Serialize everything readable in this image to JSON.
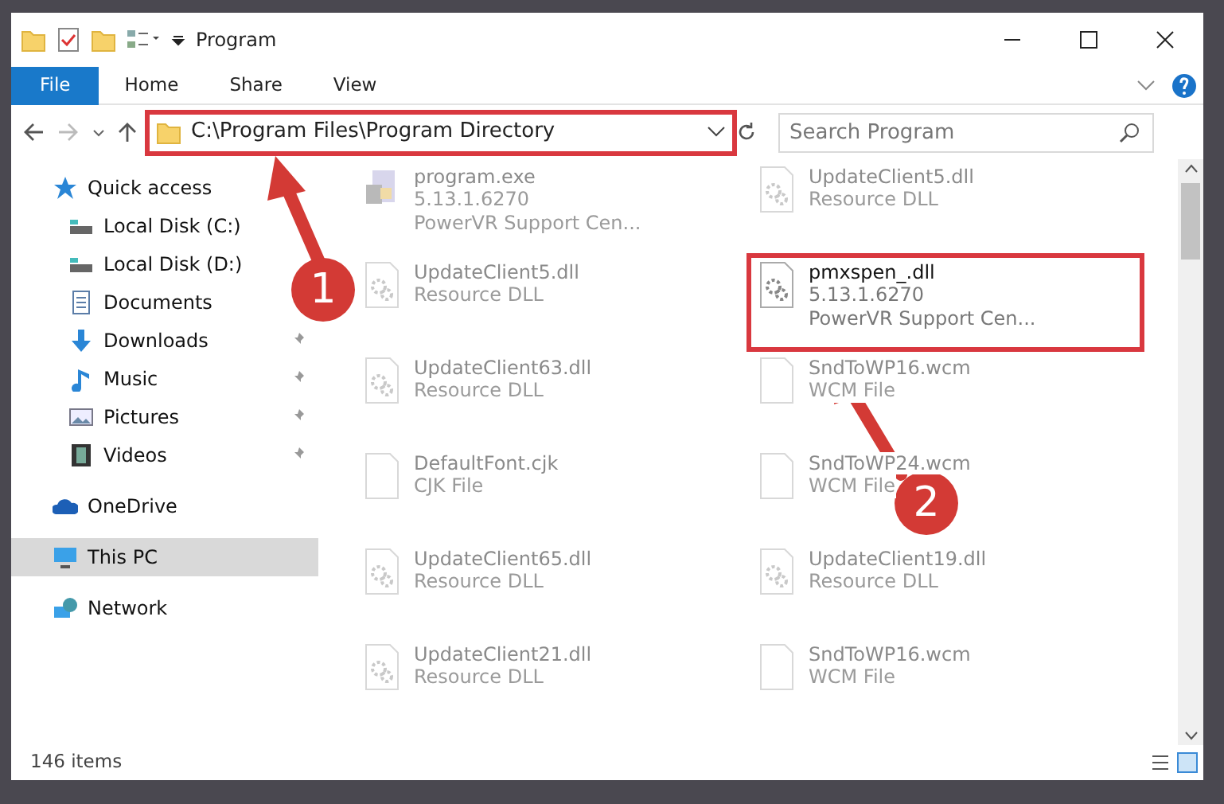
{
  "window": {
    "title": "Program"
  },
  "ribbon_tabs": [
    {
      "label": "File",
      "selected": true
    },
    {
      "label": "Home",
      "selected": false
    },
    {
      "label": "Share",
      "selected": false
    },
    {
      "label": "View",
      "selected": false
    }
  ],
  "address": {
    "value": "C:\\Program Files\\Program Directory",
    "highlighted": true
  },
  "search": {
    "placeholder": "Search Program"
  },
  "sidebar": [
    {
      "label": "Quick access",
      "kind": "star",
      "selected": false,
      "children": [
        {
          "label": "Local Disk (C:)",
          "kind": "drive",
          "pinned": false,
          "selected": false
        },
        {
          "label": "Local Disk (D:)",
          "kind": "drive",
          "pinned": false,
          "selected": false
        },
        {
          "label": "Documents",
          "kind": "doc",
          "pinned": false,
          "selected": false
        },
        {
          "label": "Downloads",
          "kind": "down",
          "pinned": true,
          "selected": false
        },
        {
          "label": "Music",
          "kind": "music",
          "pinned": true,
          "selected": false
        },
        {
          "label": "Pictures",
          "kind": "pictures",
          "pinned": true,
          "selected": false
        },
        {
          "label": "Videos",
          "kind": "videos",
          "pinned": true,
          "selected": false
        }
      ]
    },
    {
      "label": "OneDrive",
      "kind": "cloud",
      "selected": false
    },
    {
      "label": "This PC",
      "kind": "pc",
      "selected": true
    },
    {
      "label": "Network",
      "kind": "network",
      "selected": false
    }
  ],
  "files": [
    {
      "kind": "exe",
      "name": "program.exe",
      "lines": [
        "5.13.1.6270",
        "PowerVR Support Cen..."
      ],
      "dimmed": true,
      "highlighted": false
    },
    {
      "kind": "dll",
      "name": "UpdateClient5.dll",
      "lines": [
        "Resource DLL"
      ],
      "dimmed": true,
      "highlighted": false
    },
    {
      "kind": "dll",
      "name": "UpdateClient5.dll",
      "lines": [
        "Resource DLL"
      ],
      "dimmed": true,
      "highlighted": false
    },
    {
      "kind": "dll",
      "name": "pmxspen_.dll",
      "lines": [
        "5.13.1.6270",
        "PowerVR Support Cen..."
      ],
      "dimmed": false,
      "highlighted": true
    },
    {
      "kind": "dll",
      "name": "UpdateClient63.dll",
      "lines": [
        "Resource DLL"
      ],
      "dimmed": true,
      "highlighted": false
    },
    {
      "kind": "blank",
      "name": "SndToWP16.wcm",
      "lines": [
        "WCM File"
      ],
      "dimmed": true,
      "highlighted": false
    },
    {
      "kind": "blank",
      "name": "DefaultFont.cjk",
      "lines": [
        "CJK File"
      ],
      "dimmed": true,
      "highlighted": false
    },
    {
      "kind": "blank",
      "name": "SndToWP24.wcm",
      "lines": [
        "WCM File"
      ],
      "dimmed": true,
      "highlighted": false
    },
    {
      "kind": "dll",
      "name": "UpdateClient65.dll",
      "lines": [
        "Resource DLL"
      ],
      "dimmed": true,
      "highlighted": false
    },
    {
      "kind": "dll",
      "name": "UpdateClient19.dll",
      "lines": [
        "Resource DLL"
      ],
      "dimmed": true,
      "highlighted": false
    },
    {
      "kind": "dll",
      "name": "UpdateClient21.dll",
      "lines": [
        "Resource DLL"
      ],
      "dimmed": true,
      "highlighted": false
    },
    {
      "kind": "blank",
      "name": "SndToWP16.wcm",
      "lines": [
        "WCM File"
      ],
      "dimmed": true,
      "highlighted": false
    }
  ],
  "status_bar": {
    "count": "146 items"
  },
  "markers": [
    {
      "label": "1"
    },
    {
      "label": "2"
    }
  ]
}
